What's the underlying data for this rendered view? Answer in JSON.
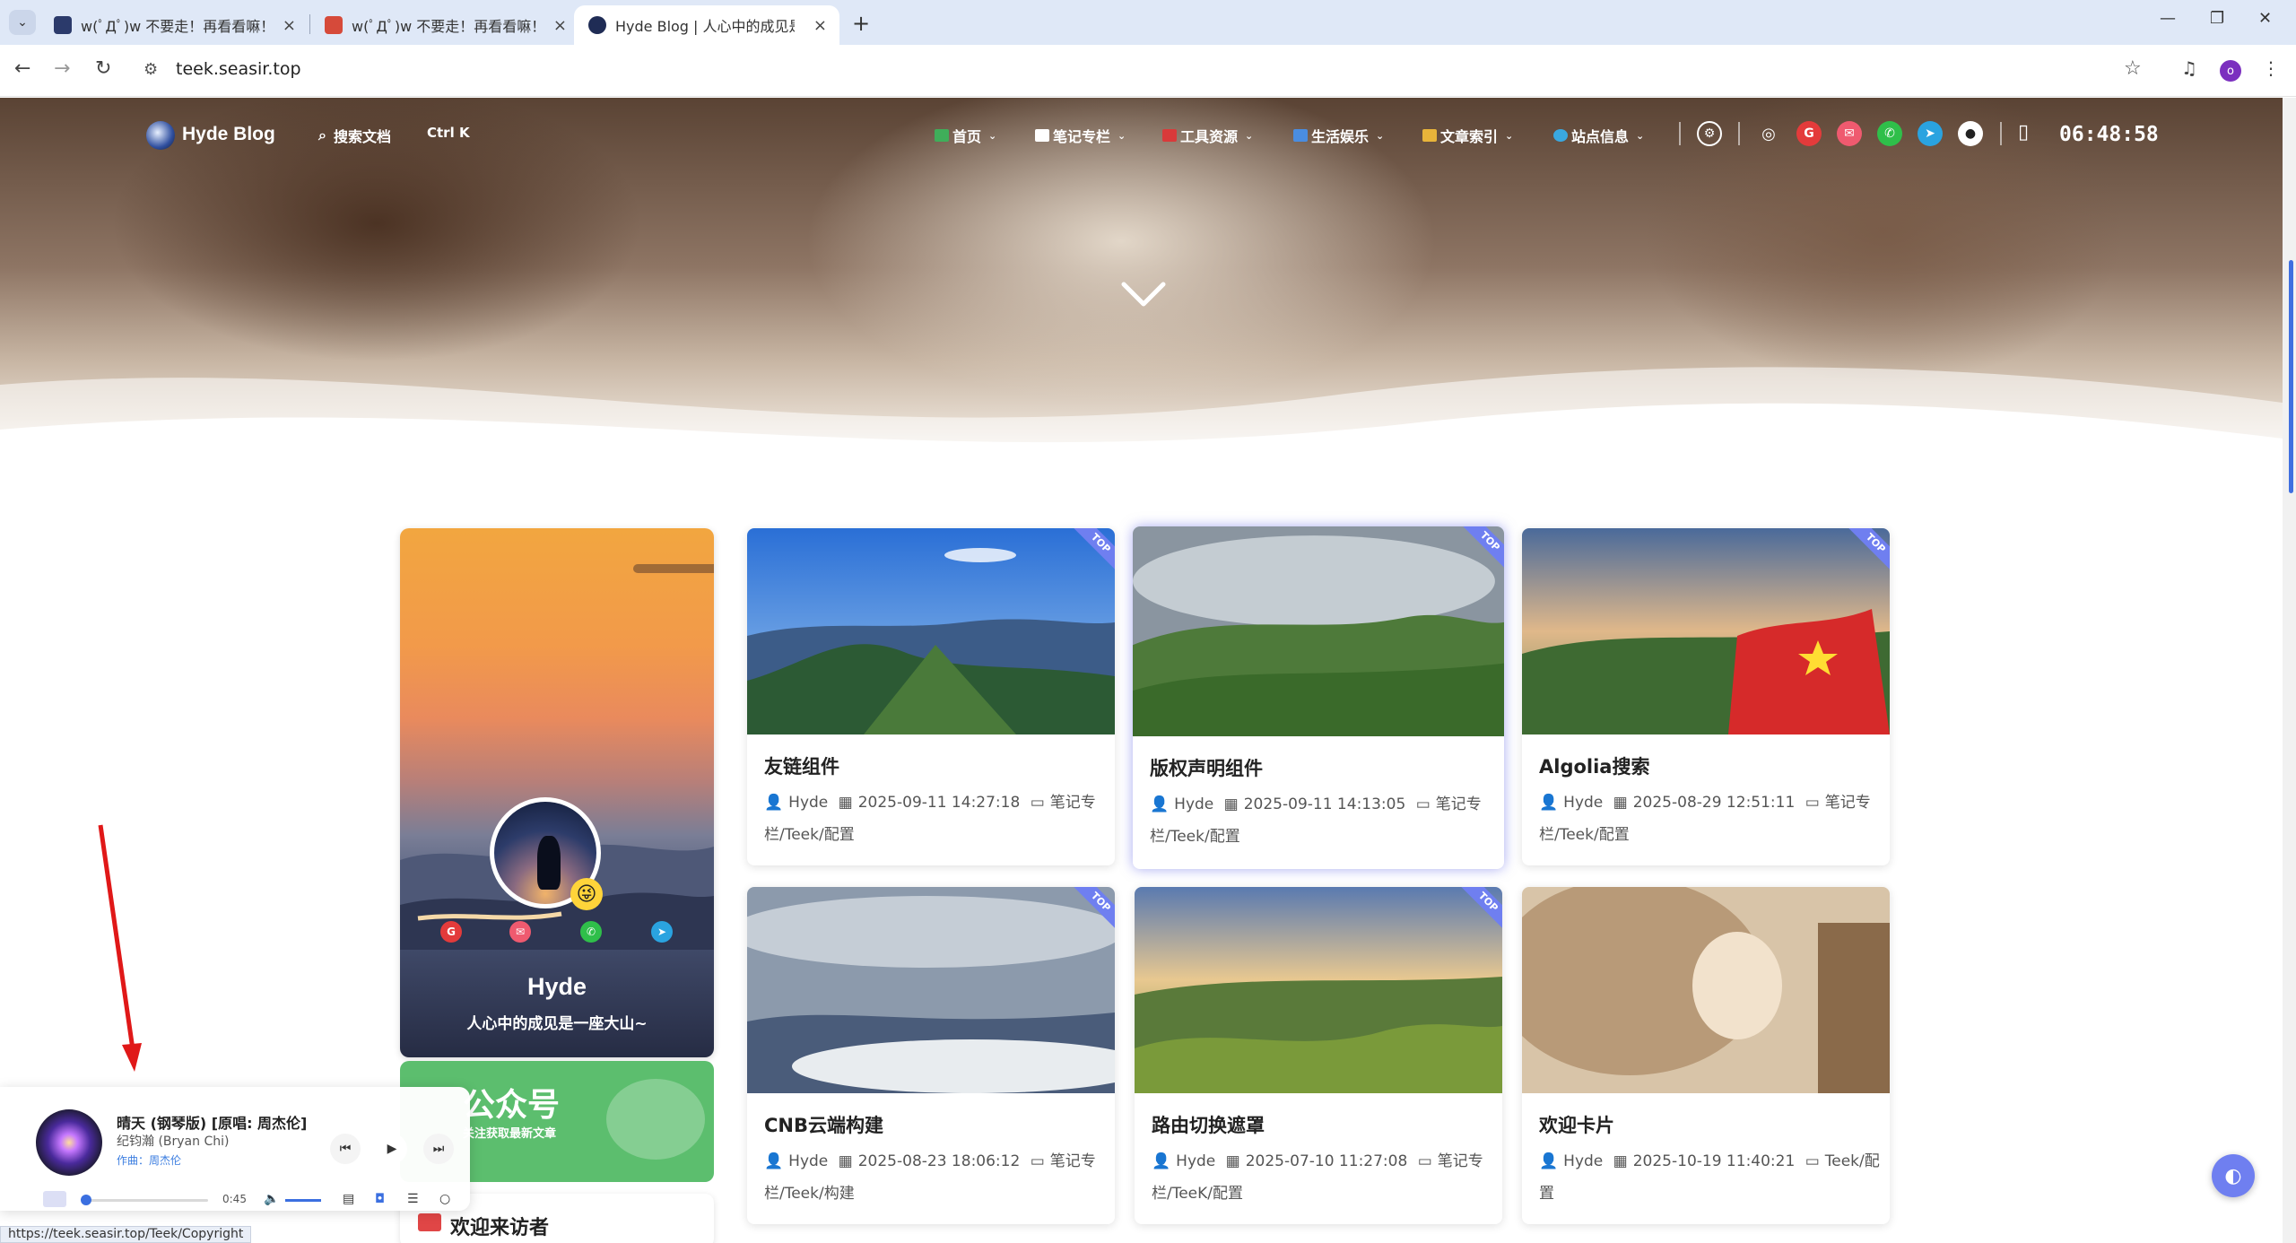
{
  "browser": {
    "tabs": [
      {
        "title": "w(ﾟДﾟ)w 不要走！再看看嘛！",
        "fav": "#2b3a6b"
      },
      {
        "title": "w(ﾟДﾟ)w 不要走！再看看嘛！",
        "fav": "#d64a3a"
      },
      {
        "title": "Hyde Blog | 人心中的成见是一",
        "fav": "#1f2c55",
        "active": true
      }
    ],
    "url": "teek.seasir.top",
    "status_url": "https://teek.seasir.top/Teek/Copyright"
  },
  "nav": {
    "logo": "Hyde Blog",
    "search_label": "搜索文档",
    "shortcut": "Ctrl K",
    "menus": [
      {
        "label": "首页",
        "color": "#3fae5a"
      },
      {
        "label": "笔记专栏",
        "color": "#ffffff"
      },
      {
        "label": "工具资源",
        "color": "#d93a3a"
      },
      {
        "label": "生活娱乐",
        "color": "#4a8de0"
      },
      {
        "label": "文章索引",
        "color": "#e8b43a"
      },
      {
        "label": "站点信息",
        "color": "#3aa8e0"
      }
    ],
    "social_colors": [
      "#e33b3b",
      "#ef5a6f",
      "#2fbf4a",
      "#2aa3e0"
    ],
    "clock": "06:48:58"
  },
  "profile": {
    "name": "Hyde",
    "motto": "人心中的成见是一座大山~",
    "social_colors": [
      "#e33b3b",
      "#ef5a6f",
      "#2fbf4a",
      "#2aa3e0"
    ],
    "emoji": "😜"
  },
  "wechat": {
    "title": "公众号",
    "subtitle": "关注获取最新文章"
  },
  "visitor": {
    "title": "欢迎来访者"
  },
  "posts": [
    {
      "title": "友链组件",
      "author": "Hyde",
      "date": "2025-09-11 14:27:18",
      "category": "笔记专栏/Teek/配置",
      "badge": "TOP"
    },
    {
      "title": "版权声明组件",
      "author": "Hyde",
      "date": "2025-09-11 14:13:05",
      "category": "笔记专栏/Teek/配置",
      "badge": "TOP"
    },
    {
      "title": "Algolia搜索",
      "author": "Hyde",
      "date": "2025-08-29 12:51:11",
      "category": "笔记专栏/Teek/配置",
      "badge": "TOP"
    },
    {
      "title": "CNB云端构建",
      "author": "Hyde",
      "date": "2025-08-23 18:06:12",
      "category": "笔记专栏/Teek/构建",
      "badge": "TOP"
    },
    {
      "title": "路由切换遮罩",
      "author": "Hyde",
      "date": "2025-07-10 11:27:08",
      "category": "笔记专栏/TeeK/配置",
      "badge": "TOP"
    },
    {
      "title": "欢迎卡片",
      "author": "Hyde",
      "date": "2025-10-19 11:40:21",
      "category": "Teek/配置",
      "badge": ""
    }
  ],
  "player": {
    "song": "晴天 (钢琴版) [原唱: 周杰伦]",
    "artist": "纪钧瀚 (Bryan Chi)",
    "lyric": "作曲：周杰伦",
    "time": "0:45",
    "progress": 0.03
  }
}
